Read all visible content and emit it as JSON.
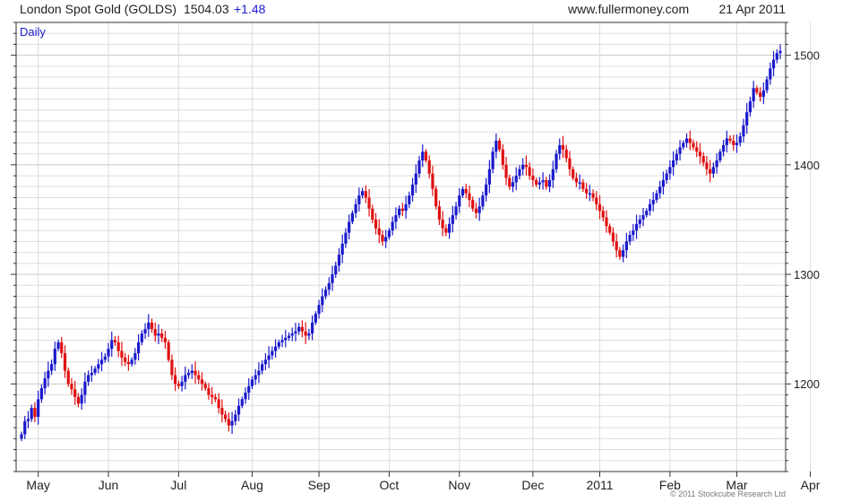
{
  "header": {
    "instrument": "London Spot Gold (GOLDS)",
    "price": "1504.03",
    "change": "+1.48",
    "site": "www.fullermoney.com",
    "date": "21 Apr 2011"
  },
  "chart_label": "Daily",
  "copyright": "© 2011 Stockcube Research Ltd",
  "colors": {
    "up": "#1a1acc",
    "down": "#e01010",
    "change": "#1a1acc",
    "grid": "#dddddd",
    "grid_major": "#c8c8c8",
    "axis": "#333333"
  },
  "chart_data": {
    "type": "ohlc",
    "title": "London Spot Gold (GOLDS)",
    "xlabel": "",
    "ylabel": "",
    "ylim": [
      1120,
      1530
    ],
    "y_ticks": [
      1200,
      1300,
      1400,
      1500
    ],
    "x_ticks": [
      "May",
      "Jun",
      "Jul",
      "Aug",
      "Sep",
      "Oct",
      "Nov",
      "Dec",
      "2011",
      "Feb",
      "Mar",
      "Apr"
    ],
    "x_tick_positions": [
      5,
      26,
      47,
      69,
      89,
      110,
      131,
      153,
      173,
      194,
      214,
      236
    ],
    "close": [
      1154,
      1166,
      1168,
      1178,
      1170,
      1186,
      1196,
      1205,
      1212,
      1218,
      1232,
      1238,
      1228,
      1212,
      1200,
      1195,
      1188,
      1182,
      1190,
      1202,
      1208,
      1210,
      1214,
      1218,
      1222,
      1225,
      1232,
      1240,
      1238,
      1230,
      1224,
      1220,
      1218,
      1222,
      1228,
      1238,
      1246,
      1250,
      1256,
      1250,
      1244,
      1246,
      1242,
      1238,
      1222,
      1208,
      1200,
      1198,
      1202,
      1208,
      1210,
      1212,
      1208,
      1204,
      1200,
      1196,
      1190,
      1188,
      1186,
      1178,
      1172,
      1168,
      1162,
      1166,
      1172,
      1180,
      1186,
      1192,
      1198,
      1204,
      1208,
      1212,
      1218,
      1222,
      1226,
      1230,
      1234,
      1238,
      1240,
      1242,
      1244,
      1246,
      1248,
      1252,
      1248,
      1244,
      1246,
      1256,
      1264,
      1272,
      1280,
      1286,
      1292,
      1300,
      1308,
      1318,
      1328,
      1338,
      1348,
      1356,
      1364,
      1372,
      1376,
      1370,
      1360,
      1350,
      1342,
      1336,
      1330,
      1334,
      1340,
      1348,
      1354,
      1360,
      1358,
      1364,
      1372,
      1382,
      1392,
      1404,
      1412,
      1404,
      1392,
      1378,
      1362,
      1350,
      1342,
      1338,
      1346,
      1354,
      1362,
      1372,
      1378,
      1374,
      1368,
      1360,
      1356,
      1362,
      1372,
      1382,
      1396,
      1412,
      1422,
      1414,
      1400,
      1388,
      1380,
      1384,
      1390,
      1396,
      1400,
      1398,
      1390,
      1386,
      1382,
      1384,
      1386,
      1380,
      1386,
      1396,
      1410,
      1418,
      1414,
      1406,
      1396,
      1388,
      1384,
      1384,
      1378,
      1374,
      1374,
      1370,
      1364,
      1358,
      1352,
      1344,
      1338,
      1330,
      1322,
      1316,
      1322,
      1330,
      1336,
      1340,
      1346,
      1350,
      1354,
      1358,
      1364,
      1368,
      1374,
      1380,
      1386,
      1392,
      1398,
      1404,
      1410,
      1416,
      1420,
      1424,
      1420,
      1416,
      1412,
      1408,
      1402,
      1396,
      1392,
      1398,
      1404,
      1412,
      1418,
      1424,
      1422,
      1418,
      1420,
      1426,
      1436,
      1448,
      1458,
      1470,
      1466,
      1462,
      1468,
      1478,
      1488,
      1496,
      1502,
      1504
    ]
  }
}
